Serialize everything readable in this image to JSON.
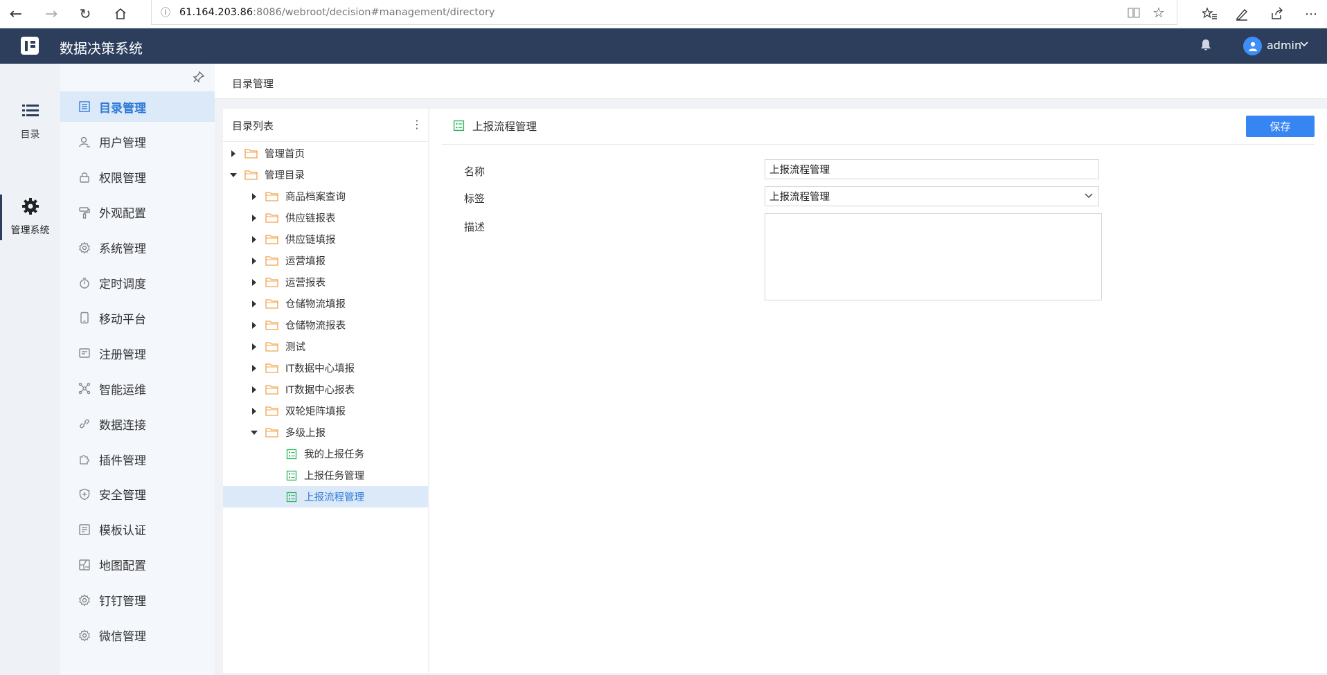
{
  "browser": {
    "url_host": "61.164.203.86",
    "url_rest": ":8086/webroot/decision#management/directory"
  },
  "app": {
    "title": "数据决策系统",
    "user": "admin"
  },
  "rail": [
    {
      "label": "目录"
    },
    {
      "label": "管理系统"
    }
  ],
  "menu": [
    {
      "label": "目录管理",
      "icon": "list-icon",
      "active": true
    },
    {
      "label": "用户管理",
      "icon": "user-icon"
    },
    {
      "label": "权限管理",
      "icon": "lock-icon"
    },
    {
      "label": "外观配置",
      "icon": "paint-roller-icon"
    },
    {
      "label": "系统管理",
      "icon": "gear-icon"
    },
    {
      "label": "定时调度",
      "icon": "timer-icon"
    },
    {
      "label": "移动平台",
      "icon": "mobile-icon"
    },
    {
      "label": "注册管理",
      "icon": "register-icon"
    },
    {
      "label": "智能运维",
      "icon": "network-icon"
    },
    {
      "label": "数据连接",
      "icon": "link-icon"
    },
    {
      "label": "插件管理",
      "icon": "puzzle-icon"
    },
    {
      "label": "安全管理",
      "icon": "shield-icon"
    },
    {
      "label": "模板认证",
      "icon": "template-icon"
    },
    {
      "label": "地图配置",
      "icon": "map-icon"
    },
    {
      "label": "钉钉管理",
      "icon": "gear-icon"
    },
    {
      "label": "微信管理",
      "icon": "gear-icon"
    }
  ],
  "breadcrumb": "目录管理",
  "tree": {
    "title": "目录列表",
    "rows": [
      {
        "label": "管理首页",
        "level": 0,
        "type": "folder",
        "expanded": false
      },
      {
        "label": "管理目录",
        "level": 0,
        "type": "folder",
        "expanded": true
      },
      {
        "label": "商品档案查询",
        "level": 1,
        "type": "folder",
        "expanded": false
      },
      {
        "label": "供应链报表",
        "level": 1,
        "type": "folder",
        "expanded": false
      },
      {
        "label": "供应链填报",
        "level": 1,
        "type": "folder",
        "expanded": false
      },
      {
        "label": "运营填报",
        "level": 1,
        "type": "folder",
        "expanded": false
      },
      {
        "label": "运营报表",
        "level": 1,
        "type": "folder",
        "expanded": false
      },
      {
        "label": "仓储物流填报",
        "level": 1,
        "type": "folder",
        "expanded": false
      },
      {
        "label": "仓储物流报表",
        "level": 1,
        "type": "folder",
        "expanded": false
      },
      {
        "label": "测试",
        "level": 1,
        "type": "folder",
        "expanded": false
      },
      {
        "label": "IT数据中心填报",
        "level": 1,
        "type": "folder",
        "expanded": false
      },
      {
        "label": "IT数据中心报表",
        "level": 1,
        "type": "folder",
        "expanded": false
      },
      {
        "label": "双轮矩阵填报",
        "level": 1,
        "type": "folder",
        "expanded": false
      },
      {
        "label": "多级上报",
        "level": 1,
        "type": "folder",
        "expanded": true
      },
      {
        "label": "我的上报任务",
        "level": 2,
        "type": "doc"
      },
      {
        "label": "上报任务管理",
        "level": 2,
        "type": "doc"
      },
      {
        "label": "上报流程管理",
        "level": 2,
        "type": "doc",
        "selected": true
      }
    ]
  },
  "detail": {
    "title": "上报流程管理",
    "save_label": "保存",
    "name_label": "名称",
    "name_value": "上报流程管理",
    "tag_label": "标签",
    "tag_value": "上报流程管理",
    "desc_label": "描述",
    "desc_value": ""
  },
  "colors": {
    "header_bg": "#2c3e5c",
    "accent": "#3685f2",
    "folder": "#f5a24a",
    "doc": "#2db45a"
  }
}
